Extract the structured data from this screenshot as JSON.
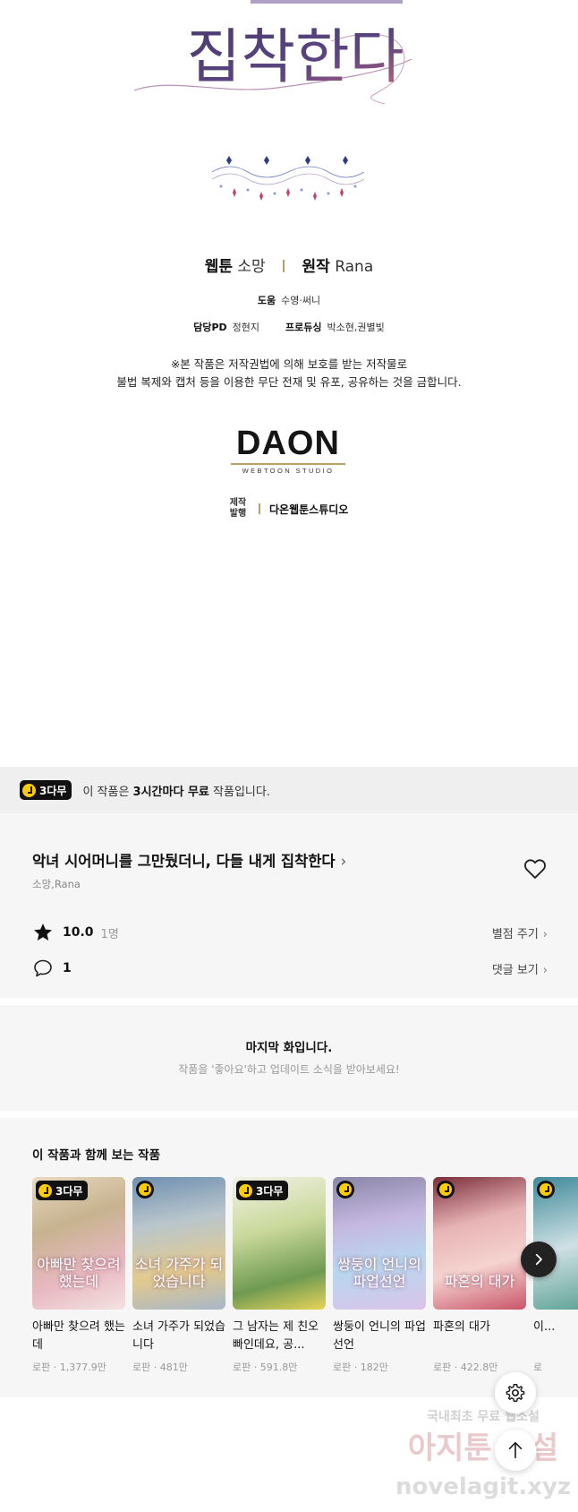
{
  "credits": {
    "title_art_text": "집착한다",
    "webtoon_label": "웹툰",
    "webtoon_value": "소망",
    "original_label": "원작",
    "original_value": "Rana",
    "assist_label": "도움",
    "assist_value": "수영·써니",
    "pd_label": "담당PD",
    "pd_value": "정현지",
    "producing_label": "프로듀싱",
    "producing_value": "박소현,권별빛",
    "notice_line1": "※본 작품은 저작권법에 의해 보호를 받는 저작물로",
    "notice_line2": "불법 복제와 캡처 등을 이용한 무단 전재 및 유포, 공유하는 것을 금합니다.",
    "logo_main": "DAON",
    "logo_sub": "WEBTOON STUDIO",
    "producer_label_1": "제작",
    "producer_label_2": "발행",
    "producer_value": "다온웹툰스튜디오"
  },
  "free_banner": {
    "badge": "3다무",
    "text_before": "이 작품은 ",
    "text_bold": "3시간마다 무료",
    "text_after": " 작품입니다."
  },
  "series": {
    "title": "악녀 시어머니를 그만뒀더니, 다들 내게 집착한다",
    "authors": "소망,Rana",
    "rating": "10.0",
    "rating_count": "1명",
    "rate_link": "별점 주기",
    "comment_count": "1",
    "comment_link": "댓글 보기"
  },
  "last_chapter": {
    "title": "마지막 화입니다.",
    "subtitle": "작품을 '좋아요'하고 업데이트 소식을 받아보세요!"
  },
  "recommendations": {
    "heading": "이 작품과 함께 보는 작품",
    "items": [
      {
        "name": "아빠만 찾으려 했는데",
        "genre": "로판",
        "views": "1,377.9만",
        "badge": "3다무",
        "art_text": "아빠만 찾으려 했는데"
      },
      {
        "name": "소녀 가주가 되었습니다",
        "genre": "로판",
        "views": "481만",
        "badge": "",
        "art_text": "소녀 가주가 되었습니다"
      },
      {
        "name": "그 남자는 제 친오빠인데요, 공...",
        "genre": "로판",
        "views": "591.8만",
        "badge": "3다무",
        "art_text": ""
      },
      {
        "name": "쌍둥이 언니의 파업 선언",
        "genre": "로판",
        "views": "182만",
        "badge": "",
        "art_text": "쌍둥이 언니의 파업선언"
      },
      {
        "name": "파혼의 대가",
        "genre": "로판",
        "views": "422.8만",
        "badge": "",
        "art_text": "파혼의 대가"
      },
      {
        "name": "이...",
        "genre": "로",
        "views": "",
        "badge": "",
        "art_text": ""
      }
    ]
  },
  "watermark": {
    "line1": "국내최초 무료 웹소설",
    "line2": "아지툰 소설",
    "line3": "novelagit.xyz"
  },
  "colors": {
    "gold_separator": "#b9a06a",
    "badge_yellow": "#ffcc00",
    "card_bg": "#f6f6f6",
    "banner_bg": "#efefef"
  },
  "icons": [
    "clock-icon",
    "chevron-right-icon",
    "heart-icon",
    "star-icon",
    "comment-icon",
    "settings-icon",
    "arrow-up-icon"
  ]
}
